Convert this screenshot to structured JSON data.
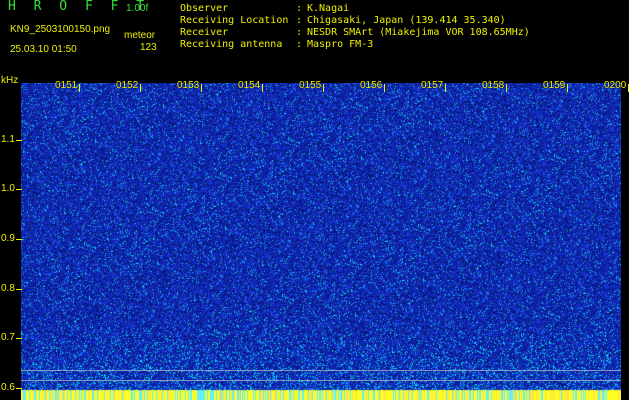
{
  "header": {
    "app_title": "H R O F F T",
    "app_version": "1.00f",
    "filename": "KN9_2503100150.png",
    "mode": "meteor",
    "datetime": "25.03.10 01:50",
    "count": "123",
    "info": [
      {
        "label": "Observer",
        "value": "K.Nagai"
      },
      {
        "label": "Receiving Location",
        "value": "Chigasaki, Japan (139.414 35.340)"
      },
      {
        "label": "Receiver",
        "value": "NESDR SMArt (Miakejima VOR 108.65MHz)"
      },
      {
        "label": "Receiving antenna",
        "value": "Maspro FM-3"
      }
    ]
  },
  "spectrogram": {
    "y_unit": "kHz",
    "y_labels": [
      "1.1",
      "1.0",
      "0.9",
      "0.8",
      "0.7",
      "0.6"
    ],
    "y_range": [
      0.575,
      1.215
    ],
    "time_labels": [
      "0151",
      "0152",
      "0153",
      "0154",
      "0155",
      "0156",
      "0157",
      "0158",
      "0159",
      "0200"
    ],
    "colors": {
      "background": "#000000",
      "text": "#f0f000",
      "title": "#38e038",
      "noise_deep": "#0a1c8c",
      "noise_mid": "#1a3adc",
      "noise_bright": "#00e0ff",
      "baseline": "#ffff00"
    }
  }
}
